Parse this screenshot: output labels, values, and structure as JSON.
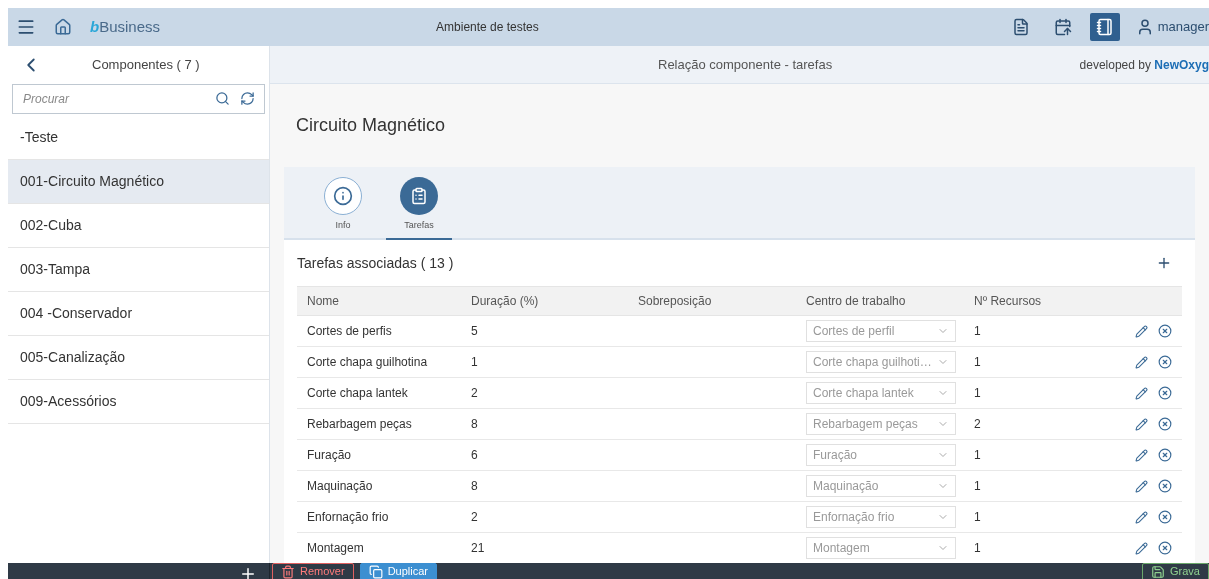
{
  "header": {
    "app_name": "bBusiness",
    "environment": "Ambiente de testes",
    "user": "manager"
  },
  "sidebar": {
    "title": "Componentes ( 7 )",
    "search_placeholder": "Procurar",
    "items": [
      {
        "label": "-Teste",
        "selected": false
      },
      {
        "label": "001-Circuito Magnético",
        "selected": true
      },
      {
        "label": "002-Cuba",
        "selected": false
      },
      {
        "label": "003-Tampa",
        "selected": false
      },
      {
        "label": "004 -Conservador",
        "selected": false
      },
      {
        "label": "005-Canalização",
        "selected": false
      },
      {
        "label": "009-Acessórios",
        "selected": false
      }
    ]
  },
  "page": {
    "subtitle": "Relação componente - tarefas",
    "credit_prefix": "developed by",
    "credit_brand": "NewOxyg",
    "object_title": "Circuito Magnético",
    "tabs": [
      {
        "label": "Info",
        "kind": "info",
        "selected": false
      },
      {
        "label": "Tarefas",
        "kind": "tasks",
        "selected": true
      }
    ]
  },
  "table": {
    "title": "Tarefas associadas ( 13 )",
    "columns": [
      "Nome",
      "Duração (%)",
      "Sobreposição",
      "Centro de trabalho",
      "Nº Recursos"
    ],
    "rows": [
      {
        "name": "Cortes de perfis",
        "duration": "5",
        "work_center": "Cortes de perfil",
        "resources": "1"
      },
      {
        "name": "Corte chapa guilhotina",
        "duration": "1",
        "work_center": "Corte chapa guilhoti…",
        "resources": "1"
      },
      {
        "name": "Corte chapa lantek",
        "duration": "2",
        "work_center": "Corte chapa lantek",
        "resources": "1"
      },
      {
        "name": "Rebarbagem peças",
        "duration": "8",
        "work_center": "Rebarbagem peças",
        "resources": "2"
      },
      {
        "name": "Furação",
        "duration": "6",
        "work_center": "Furação",
        "resources": "1"
      },
      {
        "name": "Maquinação",
        "duration": "8",
        "work_center": "Maquinação",
        "resources": "1"
      },
      {
        "name": "Enfornação frio",
        "duration": "2",
        "work_center": "Enfornação frio",
        "resources": "1"
      },
      {
        "name": "Montagem",
        "duration": "21",
        "work_center": "Montagem",
        "resources": "1"
      }
    ]
  },
  "footer": {
    "buttons": [
      {
        "label": "Remover",
        "kind": "danger"
      },
      {
        "label": "Duplicar",
        "kind": "primary"
      },
      {
        "label": "Grava",
        "kind": "save"
      }
    ]
  }
}
